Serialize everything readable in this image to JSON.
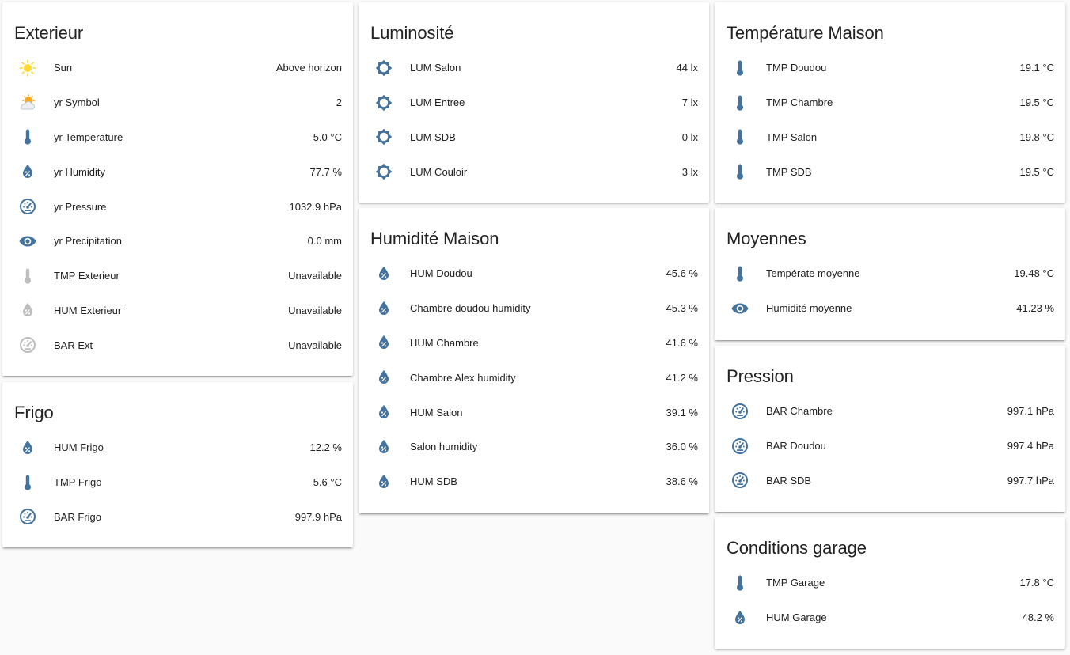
{
  "colors": {
    "icon": "#44739e",
    "icon_unavailable": "#bdbdbd",
    "sun": "#fdd835",
    "background": "#fafafa"
  },
  "cards": [
    {
      "id": "exterieur",
      "title": "Exterieur",
      "rows": [
        {
          "icon": "sun-icon",
          "name": "Sun",
          "value": "Above horizon"
        },
        {
          "icon": "weather-partly-cloudy-icon",
          "name": "yr Symbol",
          "value": "2"
        },
        {
          "icon": "thermometer-icon",
          "name": "yr Temperature",
          "value": "5.0 °C"
        },
        {
          "icon": "humidity-icon",
          "name": "yr Humidity",
          "value": "77.7 %"
        },
        {
          "icon": "gauge-icon",
          "name": "yr Pressure",
          "value": "1032.9 hPa"
        },
        {
          "icon": "eye-icon",
          "name": "yr Precipitation",
          "value": "0.0 mm"
        },
        {
          "icon": "thermometer-icon",
          "name": "TMP Exterieur",
          "value": "Unavailable",
          "unavailable": true
        },
        {
          "icon": "humidity-icon",
          "name": "HUM Exterieur",
          "value": "Unavailable",
          "unavailable": true
        },
        {
          "icon": "gauge-icon",
          "name": "BAR Ext",
          "value": "Unavailable",
          "unavailable": true
        }
      ]
    },
    {
      "id": "frigo",
      "title": "Frigo",
      "rows": [
        {
          "icon": "humidity-icon",
          "name": "HUM Frigo",
          "value": "12.2 %"
        },
        {
          "icon": "thermometer-icon",
          "name": "TMP Frigo",
          "value": "5.6 °C"
        },
        {
          "icon": "gauge-icon",
          "name": "BAR Frigo",
          "value": "997.9 hPa"
        }
      ]
    },
    {
      "id": "luminosite",
      "title": "Luminosité",
      "rows": [
        {
          "icon": "brightness-icon",
          "name": "LUM Salon",
          "value": "44 lx"
        },
        {
          "icon": "brightness-icon",
          "name": "LUM Entree",
          "value": "7 lx"
        },
        {
          "icon": "brightness-icon",
          "name": "LUM SDB",
          "value": "0 lx"
        },
        {
          "icon": "brightness-icon",
          "name": "LUM Couloir",
          "value": "3 lx"
        }
      ]
    },
    {
      "id": "humidite-maison",
      "title": "Humidité Maison",
      "rows": [
        {
          "icon": "humidity-icon",
          "name": "HUM Doudou",
          "value": "45.6 %"
        },
        {
          "icon": "humidity-icon",
          "name": "Chambre doudou humidity",
          "value": "45.3 %"
        },
        {
          "icon": "humidity-icon",
          "name": "HUM Chambre",
          "value": "41.6 %"
        },
        {
          "icon": "humidity-icon",
          "name": "Chambre Alex humidity",
          "value": "41.2 %"
        },
        {
          "icon": "humidity-icon",
          "name": "HUM Salon",
          "value": "39.1 %"
        },
        {
          "icon": "humidity-icon",
          "name": "Salon humidity",
          "value": "36.0 %"
        },
        {
          "icon": "humidity-icon",
          "name": "HUM SDB",
          "value": "38.6 %"
        }
      ]
    },
    {
      "id": "temperature-maison",
      "title": "Température Maison",
      "rows": [
        {
          "icon": "thermometer-icon",
          "name": "TMP Doudou",
          "value": "19.1 °C"
        },
        {
          "icon": "thermometer-icon",
          "name": "TMP Chambre",
          "value": "19.5 °C"
        },
        {
          "icon": "thermometer-icon",
          "name": "TMP Salon",
          "value": "19.8 °C"
        },
        {
          "icon": "thermometer-icon",
          "name": "TMP SDB",
          "value": "19.5 °C"
        }
      ]
    },
    {
      "id": "moyennes",
      "title": "Moyennes",
      "rows": [
        {
          "icon": "thermometer-icon",
          "name": "Températe moyenne",
          "value": "19.48 °C"
        },
        {
          "icon": "eye-icon",
          "name": "Humidité moyenne",
          "value": "41.23 %"
        }
      ]
    },
    {
      "id": "pression",
      "title": "Pression",
      "rows": [
        {
          "icon": "gauge-icon",
          "name": "BAR Chambre",
          "value": "997.1 hPa"
        },
        {
          "icon": "gauge-icon",
          "name": "BAR Doudou",
          "value": "997.4 hPa"
        },
        {
          "icon": "gauge-icon",
          "name": "BAR SDB",
          "value": "997.7 hPa"
        }
      ]
    },
    {
      "id": "conditions-garage",
      "title": "Conditions garage",
      "rows": [
        {
          "icon": "thermometer-icon",
          "name": "TMP Garage",
          "value": "17.8 °C"
        },
        {
          "icon": "humidity-icon",
          "name": "HUM Garage",
          "value": "48.2 %"
        }
      ]
    }
  ]
}
